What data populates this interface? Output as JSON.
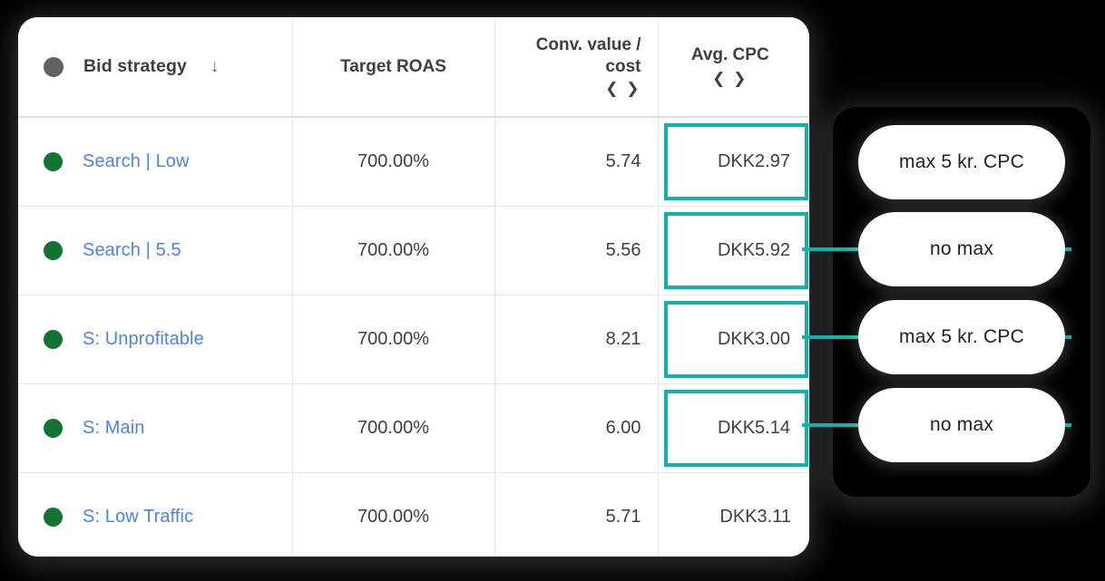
{
  "colors": {
    "background": "#000000",
    "panel": "#ffffff",
    "highlight_teal": "#0fb3ab",
    "status_green": "#137333",
    "link_blue": "#4b83f0",
    "header_text": "#3c4043",
    "grid_line": "#e6e7ea",
    "header_dot": "#5f6368"
  },
  "table": {
    "columns": [
      {
        "key": "bid_strategy",
        "label": "Bid strategy",
        "sort_icon": "↓",
        "align": "left",
        "leading_icon": "filled-circle-icon"
      },
      {
        "key": "target_roas",
        "label": "Target ROAS",
        "align": "center"
      },
      {
        "key": "conv_value_cost",
        "label": "Conv. value / cost",
        "label_line1": "Conv. value /",
        "label_line2": "cost",
        "align": "right",
        "trailing_icon": "❮ ❯"
      },
      {
        "key": "avg_cpc",
        "label": "Avg. CPC",
        "align": "center",
        "trailing_icon": "❮ ❯"
      }
    ],
    "rows": [
      {
        "status": "enabled",
        "bid_strategy": "Search | Low",
        "target_roas": "700.00%",
        "conv_value_cost": "5.74",
        "avg_cpc": "DKK2.97",
        "avg_cpc_highlighted": true
      },
      {
        "status": "enabled",
        "bid_strategy": "Search | 5.5",
        "target_roas": "700.00%",
        "conv_value_cost": "5.56",
        "avg_cpc": "DKK5.92",
        "avg_cpc_highlighted": true
      },
      {
        "status": "enabled",
        "bid_strategy": "S: Unprofitable",
        "target_roas": "700.00%",
        "conv_value_cost": "8.21",
        "avg_cpc": "DKK3.00",
        "avg_cpc_highlighted": true
      },
      {
        "status": "enabled",
        "bid_strategy": "S: Main",
        "target_roas": "700.00%",
        "conv_value_cost": "6.00",
        "avg_cpc": "DKK5.14",
        "avg_cpc_highlighted": true
      },
      {
        "status": "enabled",
        "bid_strategy": "S: Low Traffic",
        "target_roas": "700.00%",
        "conv_value_cost": "5.71",
        "avg_cpc": "DKK3.11",
        "avg_cpc_highlighted": false
      }
    ]
  },
  "callouts": [
    {
      "label": "max 5 kr. CPC",
      "connected": false
    },
    {
      "label": "no max",
      "connected": true
    },
    {
      "label": "max 5 kr. CPC",
      "connected": true
    },
    {
      "label": "no max",
      "connected": true
    }
  ]
}
